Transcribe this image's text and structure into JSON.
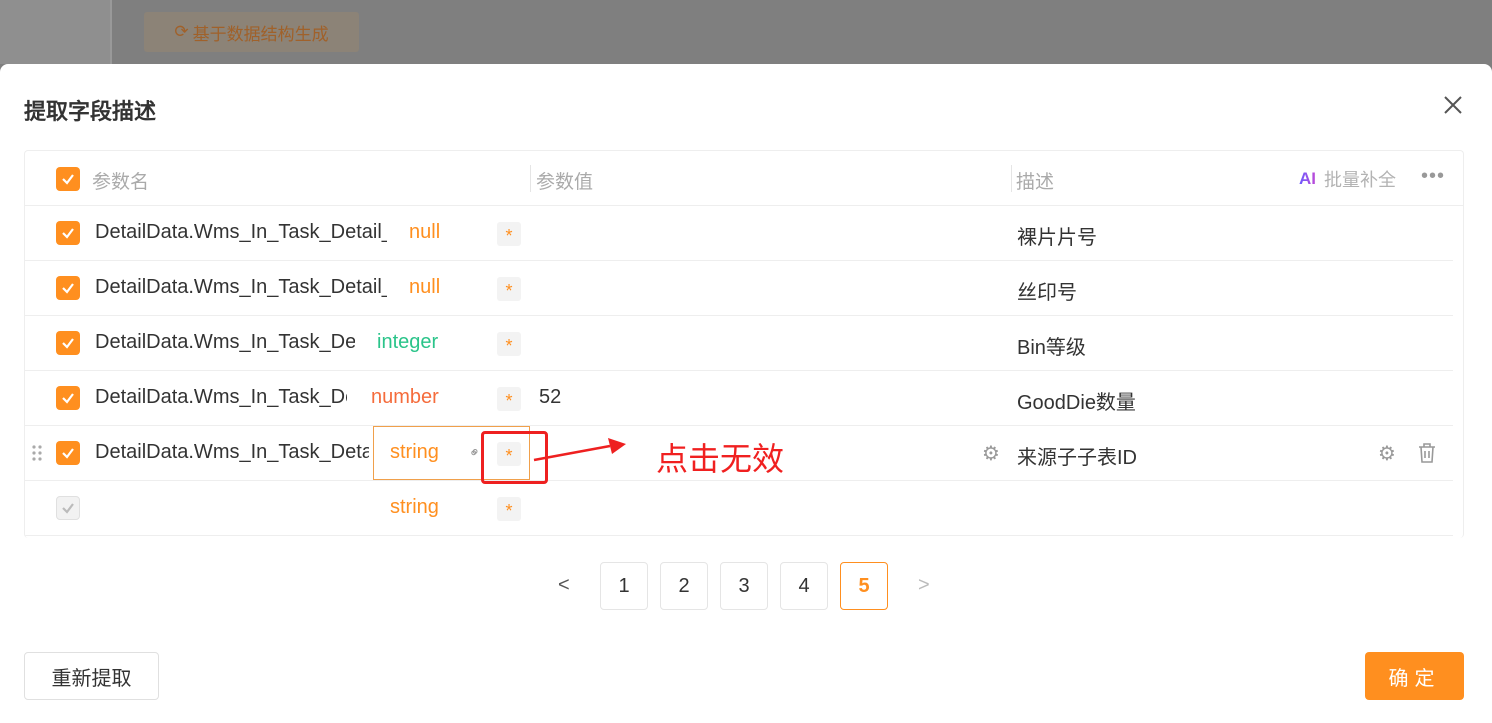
{
  "background": {
    "generate_button_label": "基于数据结构生成",
    "generate_icon": "refresh-icon"
  },
  "modal": {
    "title": "提取字段描述",
    "close_icon": "close-icon"
  },
  "table": {
    "headers": {
      "param_name": "参数名",
      "param_value": "参数值",
      "description": "描述"
    },
    "ai_logo": "AI",
    "ai_batch_label": "批量补全",
    "more_icon": "more-icon",
    "rows": [
      {
        "name": "DetailData.Wms_In_Task_Detail_",
        "type": "null",
        "value": "",
        "description": "裸片片号",
        "checked": true
      },
      {
        "name": "DetailData.Wms_In_Task_Detail_",
        "type": "null",
        "value": "",
        "description": "丝印号",
        "checked": true
      },
      {
        "name": "DetailData.Wms_In_Task_Det",
        "type": "integer",
        "value": "",
        "description": "Bin等级",
        "checked": true
      },
      {
        "name": "DetailData.Wms_In_Task_De",
        "type": "number",
        "value": "52",
        "description": "GoodDie数量",
        "checked": true
      },
      {
        "name": "DetailData.Wms_In_Task_Deta",
        "type": "string",
        "value": "",
        "description": "来源子子表ID",
        "checked": true
      },
      {
        "name": "",
        "type": "string",
        "value": "",
        "description": "",
        "checked": true,
        "disabled": true
      }
    ],
    "required_mark": "*"
  },
  "annotation": {
    "text": "点击无效",
    "color": "#ee2020"
  },
  "pagination": {
    "pages": [
      "1",
      "2",
      "3",
      "4",
      "5"
    ],
    "current": "5",
    "prev": "<",
    "next": ">"
  },
  "footer": {
    "reextract_label": "重新提取",
    "confirm_label": "确定"
  },
  "colors": {
    "accent": "#ff8f1f",
    "null": "#ff8f1f",
    "integer": "#2bc48a",
    "number": "#f56c3c",
    "string": "#ff8f1f"
  }
}
